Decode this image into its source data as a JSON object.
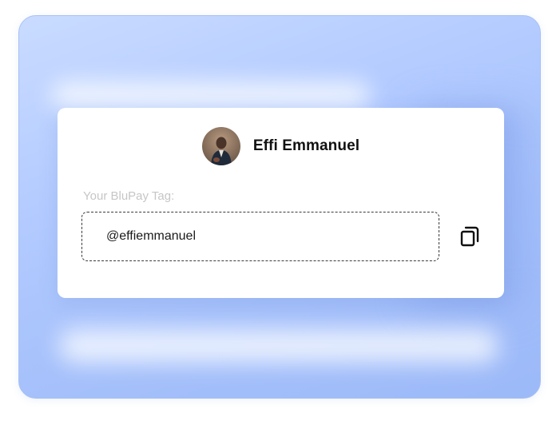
{
  "profile": {
    "name": "Effi Emmanuel",
    "avatar_icon": "user-photo-avatar"
  },
  "tag": {
    "label": "Your BluPay Tag:",
    "value": "@effiemmanuel"
  },
  "actions": {
    "copy_icon": "copy-icon"
  },
  "colors": {
    "background_gradient_start": "#c9dbff",
    "background_gradient_end": "#9cb9f8",
    "card": "#ffffff",
    "label_text": "#c6c6c6",
    "primary_text": "#111111"
  }
}
